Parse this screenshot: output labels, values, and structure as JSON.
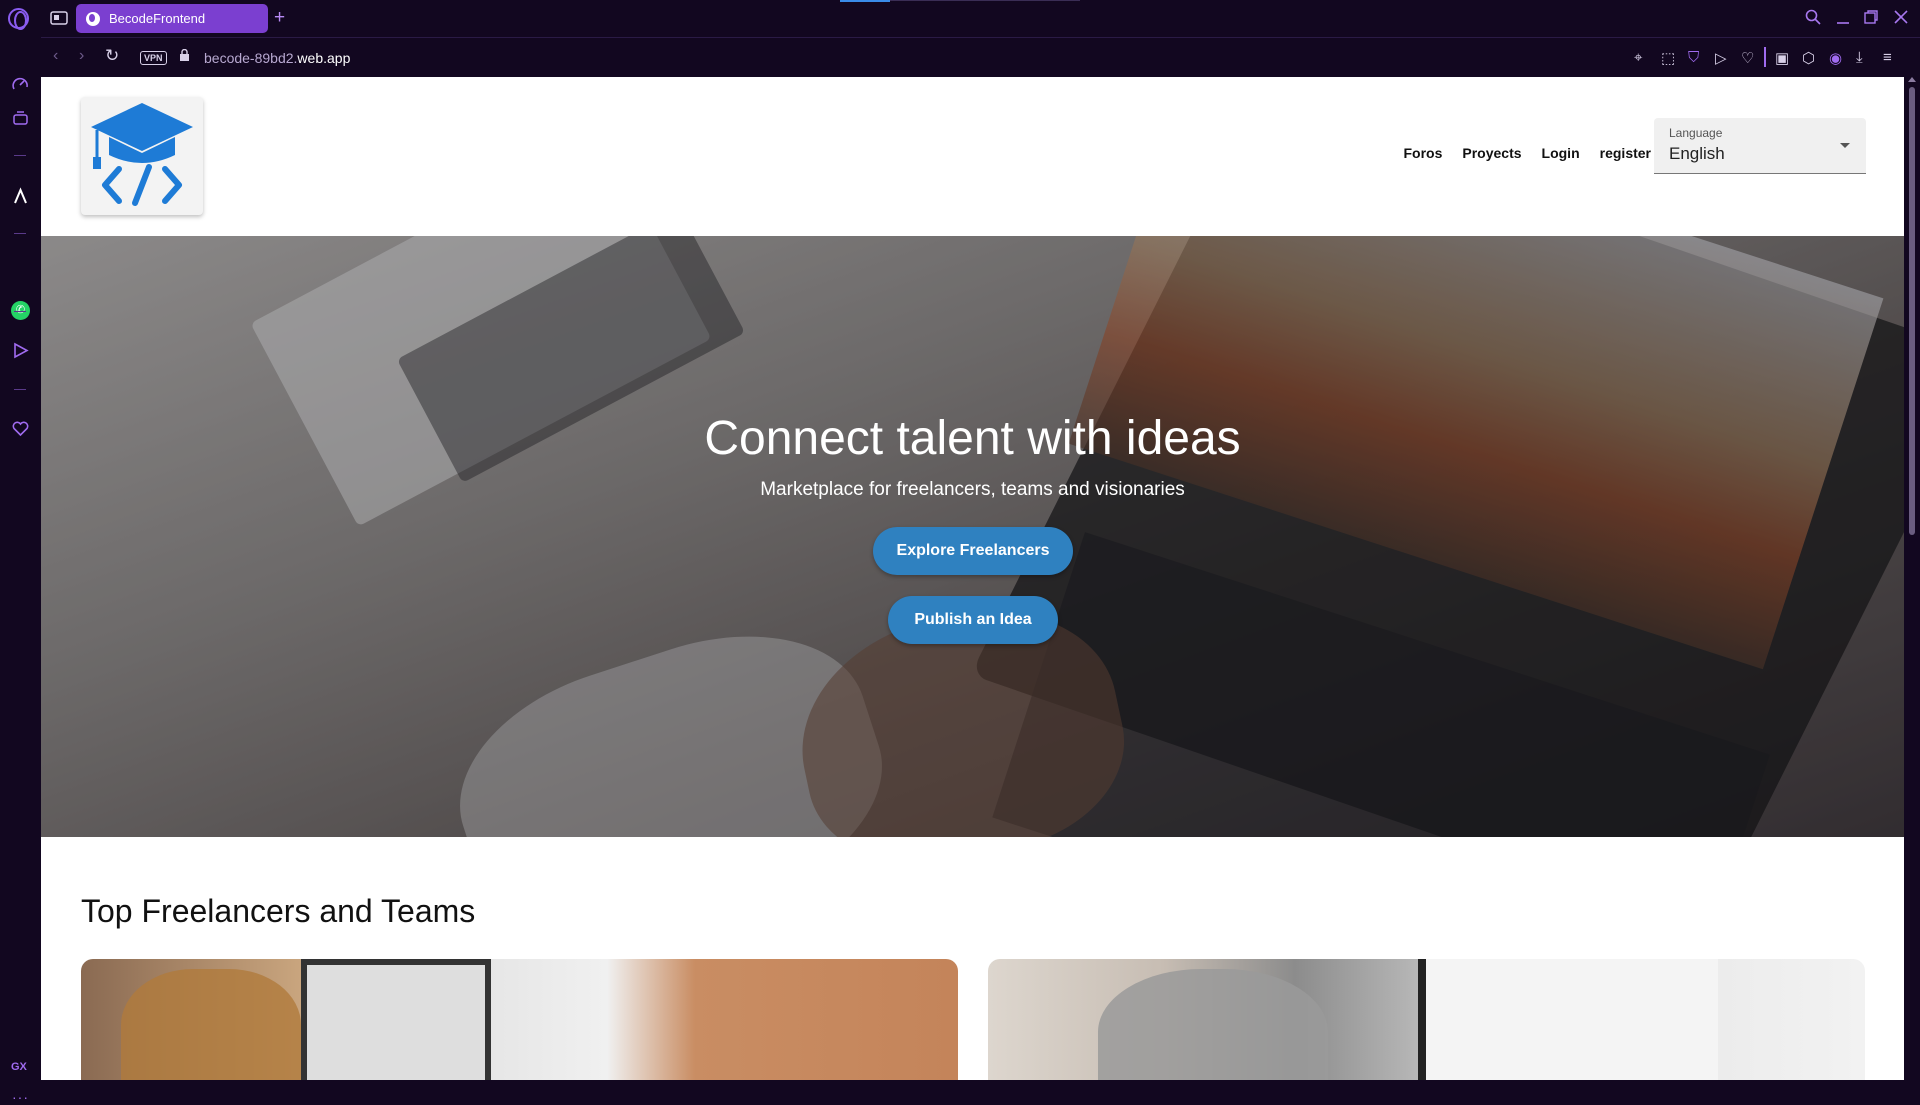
{
  "browser": {
    "tab_title": "BecodeFrontend",
    "new_tab_symbol": "+",
    "url_prefix": "becode-89bd2.",
    "url_domain": "web.app",
    "vpn_label": "VPN",
    "sidebar_footer": "GX",
    "sidebar_more": "···"
  },
  "site": {
    "nav": {
      "foros": "Foros",
      "proyects": "Proyects",
      "login": "Login",
      "register": "register"
    },
    "language": {
      "label": "Language",
      "value": "English"
    },
    "hero": {
      "title": "Connect talent with ideas",
      "subtitle": "Marketplace for freelancers, teams and visionaries",
      "explore_button": "Explore Freelancers",
      "publish_button": "Publish an Idea"
    },
    "section": {
      "title": "Top Freelancers and Teams"
    }
  },
  "colors": {
    "browser_bg": "#120720",
    "tab_active": "#7b3fd0",
    "accent": "#a06bf0",
    "primary_button": "#2f81c0",
    "logo_blue": "#1e7bd6"
  },
  "icons": {
    "logo": "graduation-cap-code-icon",
    "lang_dropdown": "caret-down-icon"
  }
}
